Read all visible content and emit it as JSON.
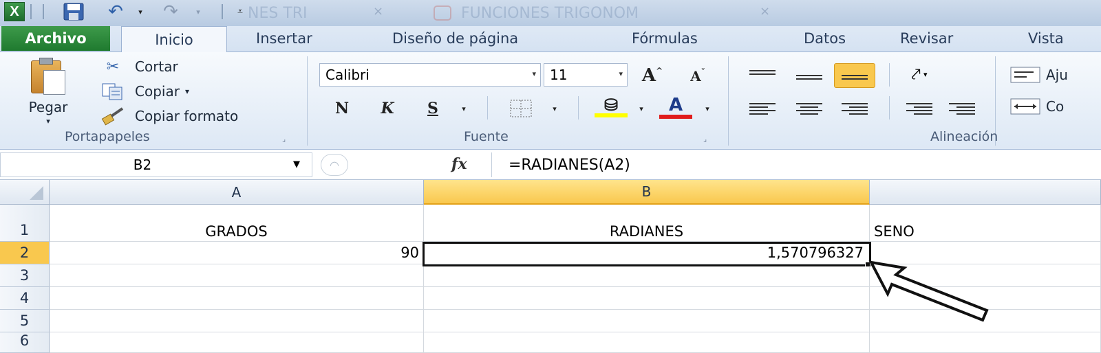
{
  "quick_access": {
    "logo_letter": "X",
    "undo_arrow": "▾",
    "redo_arrow": "▾",
    "customize_glyph": "⩡"
  },
  "window": {
    "doc_tab_1": "NES TRI",
    "doc_tab_2": "FUNCIONES TRIGONOM",
    "close_glyph": "×"
  },
  "tabs": [
    {
      "label": "Archivo"
    },
    {
      "label": "Inicio"
    },
    {
      "label": "Insertar"
    },
    {
      "label": "Diseño de página"
    },
    {
      "label": "Fórmulas"
    },
    {
      "label": "Datos"
    },
    {
      "label": "Revisar"
    },
    {
      "label": "Vista"
    }
  ],
  "ribbon": {
    "clipboard": {
      "paste": "Pegar",
      "cut": "Cortar",
      "copy": "Copiar",
      "copy_arrow": "▾",
      "format_painter": "Copiar formato",
      "label": "Portapapeles"
    },
    "font": {
      "name": "Calibri",
      "size": "11",
      "bold": "N",
      "italic": "K",
      "underline": "S",
      "grow": "A",
      "shrink": "A",
      "font_color": "A",
      "highlight_color": "#ffff00",
      "text_color": "#e01c1c",
      "label": "Fuente"
    },
    "alignment": {
      "wrap": "Aju",
      "merge": "Co",
      "label": "Alineación",
      "active_color": "#f9c84e"
    }
  },
  "formula_bar": {
    "name_box": "B2",
    "fx": "fx",
    "formula": "=RADIANES(A2)"
  },
  "sheet": {
    "columns": [
      "A",
      "B"
    ],
    "rows": [
      "1",
      "2",
      "3",
      "4",
      "5",
      "6"
    ],
    "cells": {
      "A1": "GRADOS",
      "B1": "RADIANES",
      "C1": "SENO",
      "A2": "90",
      "B2": "1,570796327"
    },
    "active_cell": "B2",
    "highlight_color": "#f9c84e"
  }
}
